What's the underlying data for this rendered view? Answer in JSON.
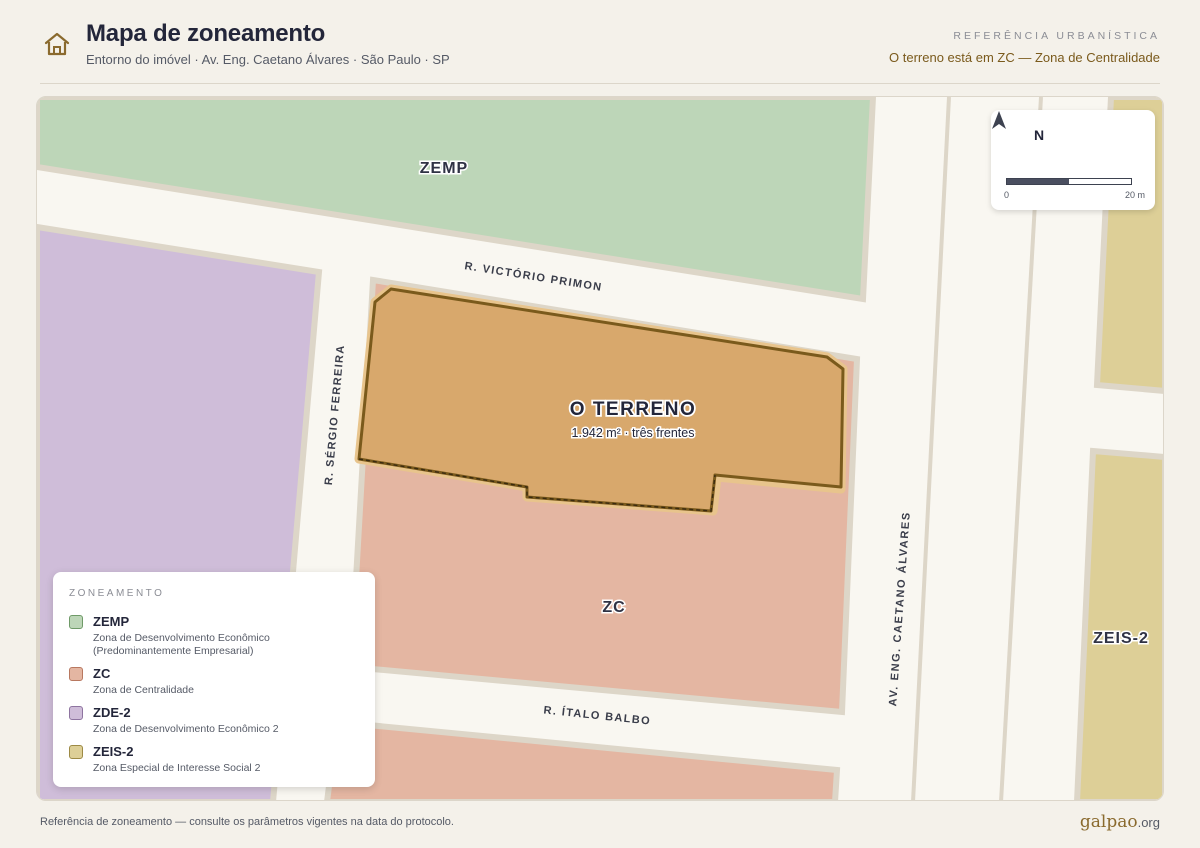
{
  "header": {
    "title": "Mapa de zoneamento",
    "subtitle": "Entorno do imóvel · Av. Eng. Caetano Álvares · São Paulo · SP",
    "eyebrow": "Referência urbanística",
    "zone_note": "O terreno está em ZC — Zona de Centralidade",
    "icon": "home-icon"
  },
  "colors": {
    "zemp": "#bdd6b8",
    "zc": "#e4b6a2",
    "zde2": "#cfbdd9",
    "zeis2": "#ddcf97",
    "plot": "#d8a86c",
    "plot_outline": "#7a5a1c",
    "accent": "#7a5a1c"
  },
  "map": {
    "zone_labels": {
      "zemp": "ZEMP",
      "zc": "ZC",
      "zeis2": "ZEIS-2"
    },
    "streets": {
      "victorio": "R. VICTÓRIO PRIMON",
      "sergio": "R. SÉRGIO FERREIRA",
      "italo": "R. ÍTALO BALBO",
      "caetano": "AV. ENG. CAETANO ÁLVARES"
    },
    "plot": {
      "label": "O TERRENO",
      "detail": "1.942 m² · três frentes"
    },
    "scale": {
      "north": "N",
      "zero": "0",
      "max": "20 m",
      "north_icon": "north-arrow-icon"
    }
  },
  "legend": {
    "title": "Zoneamento",
    "items": [
      {
        "code": "ZEMP",
        "desc": "Zona de Desenvolvimento Econômico (Predominantemente Empresarial)",
        "color": "#bdd6b8",
        "border": "#6f9a68"
      },
      {
        "code": "ZC",
        "desc": "Zona de Centralidade",
        "color": "#e4b6a2",
        "border": "#b87860"
      },
      {
        "code": "ZDE-2",
        "desc": "Zona de Desenvolvimento Econômico 2",
        "color": "#cfbdd9",
        "border": "#8e74a0"
      },
      {
        "code": "ZEIS-2",
        "desc": "Zona Especial de Interesse Social 2",
        "color": "#ddcf97",
        "border": "#9d8a45"
      }
    ]
  },
  "footer": {
    "note": "Referência de zoneamento — consulte os parâmetros vigentes na data do protocolo.",
    "brand_name": "galpao",
    "brand_tld": ".org"
  }
}
